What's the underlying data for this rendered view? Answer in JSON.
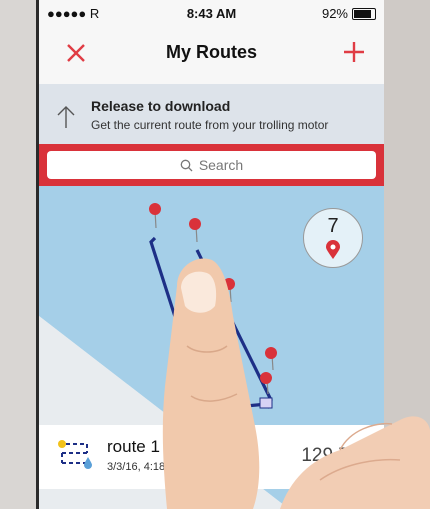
{
  "status_bar": {
    "carrier": "●●●●● R",
    "time": "8:43 AM",
    "battery_pct": "92%",
    "battery_level": 0.92
  },
  "nav": {
    "title": "My Routes",
    "close_icon": "close-icon",
    "add_icon": "plus-icon"
  },
  "pull_to_refresh": {
    "title": "Release to download",
    "subtitle": "Get the current route from your trolling motor"
  },
  "search": {
    "placeholder": "Search"
  },
  "map": {
    "marker_count": "7"
  },
  "routes": [
    {
      "name": "route 1",
      "date": "3/3/16, 4:18 P",
      "distance": "129.7 M"
    }
  ],
  "colors": {
    "accent": "#e03c44",
    "search_band": "#d9323a",
    "route_line": "#1d2f86",
    "water": "#a5cfe8"
  }
}
